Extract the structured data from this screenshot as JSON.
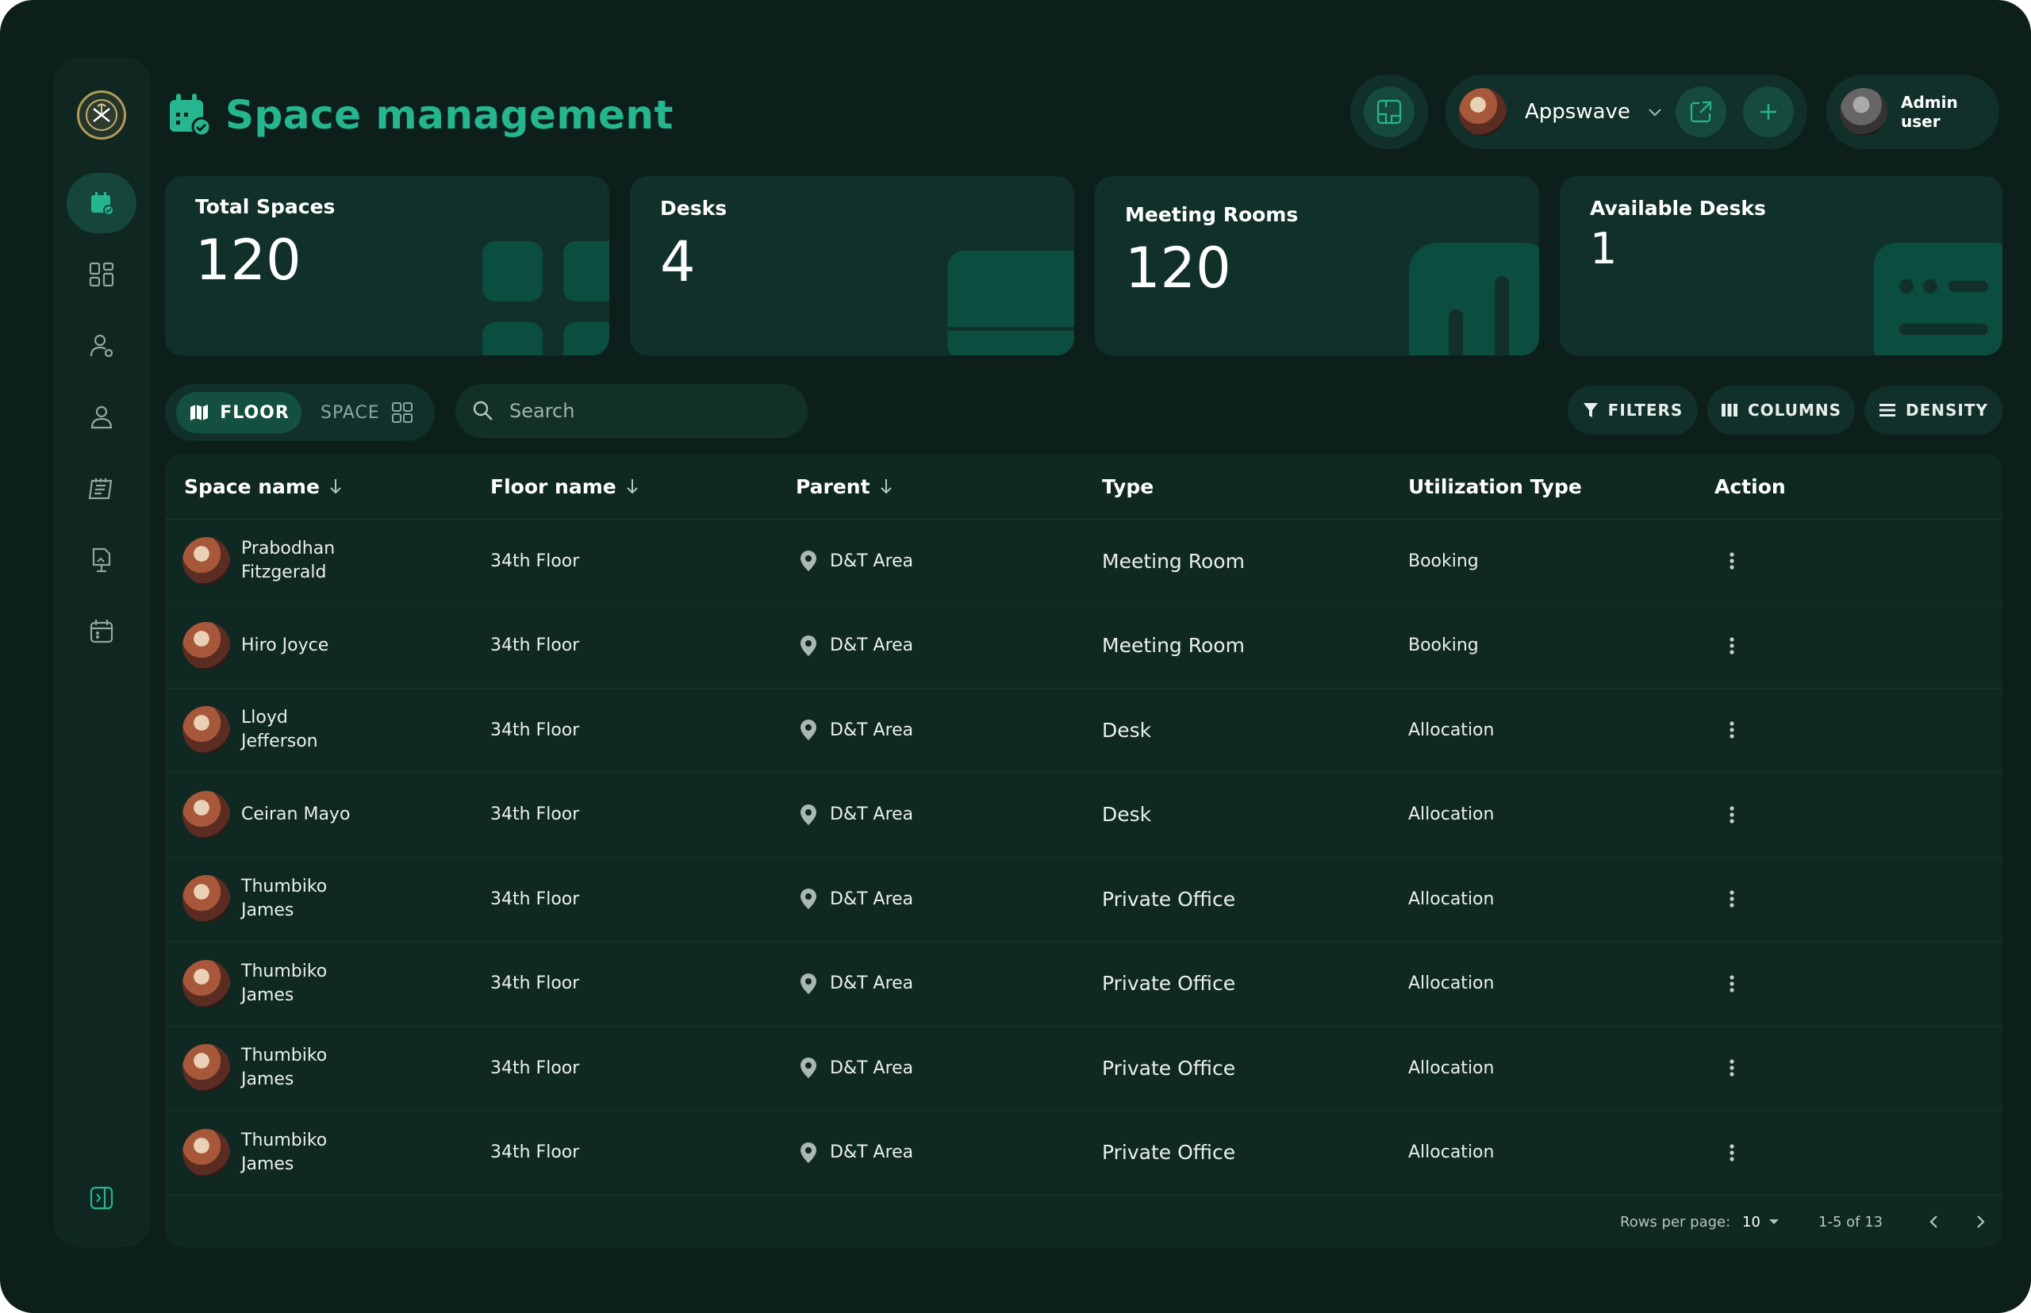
{
  "header": {
    "title": "Space management",
    "workspace": "Appswave",
    "user_name": "Admin user"
  },
  "stats": [
    {
      "label": "Total Spaces",
      "value": "120"
    },
    {
      "label": "Desks",
      "value": "4"
    },
    {
      "label": "Meeting Rooms",
      "value": "120"
    },
    {
      "label": "Available Desks",
      "value": "1"
    }
  ],
  "toolbar": {
    "floor_label": "FLOOR",
    "space_label": "SPACE",
    "search_placeholder": "Search",
    "filters_label": "FILTERS",
    "columns_label": "COLUMNS",
    "density_label": "DENSITY"
  },
  "table": {
    "columns": [
      "Space name",
      "Floor name",
      "Parent",
      "Type",
      "Utilization Type",
      "Action"
    ],
    "rows": [
      {
        "space": "Prabodhan Fitzgerald",
        "floor": "34th Floor",
        "parent": "D&T Area",
        "type": "Meeting Room",
        "utilization": "Booking"
      },
      {
        "space": "Hiro Joyce",
        "floor": "34th Floor",
        "parent": "D&T Area",
        "type": "Meeting Room",
        "utilization": "Booking"
      },
      {
        "space": "Lloyd Jefferson",
        "floor": "34th Floor",
        "parent": "D&T Area",
        "type": "Desk",
        "utilization": "Allocation"
      },
      {
        "space": "Ceiran Mayo",
        "floor": "34th Floor",
        "parent": "D&T Area",
        "type": "Desk",
        "utilization": "Allocation"
      },
      {
        "space": "Thumbiko James",
        "floor": "34th Floor",
        "parent": "D&T Area",
        "type": "Private Office",
        "utilization": "Allocation"
      },
      {
        "space": "Thumbiko James",
        "floor": "34th Floor",
        "parent": "D&T Area",
        "type": "Private Office",
        "utilization": "Allocation"
      },
      {
        "space": "Thumbiko James",
        "floor": "34th Floor",
        "parent": "D&T Area",
        "type": "Private Office",
        "utilization": "Allocation"
      },
      {
        "space": "Thumbiko James",
        "floor": "34th Floor",
        "parent": "D&T Area",
        "type": "Private Office",
        "utilization": "Allocation"
      }
    ]
  },
  "pagination": {
    "rows_per_page_label": "Rows per page:",
    "rows_per_page": "10",
    "range": "1-5 of 13"
  },
  "colors": {
    "background": "#0d1f1b",
    "accent": "#25b690",
    "card": "#11302a",
    "deco": "#0b4d3f"
  }
}
